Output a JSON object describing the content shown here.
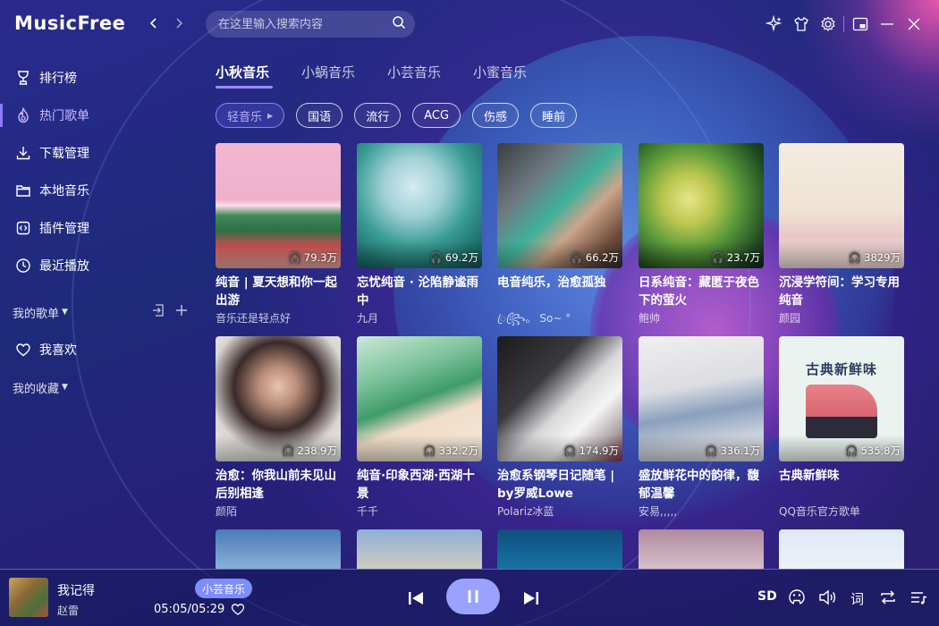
{
  "app": {
    "title": "MusicFree"
  },
  "search": {
    "placeholder": "在这里输入搜索内容"
  },
  "sidebar": {
    "items": [
      {
        "label": "排行榜",
        "icon": "trophy-icon"
      },
      {
        "label": "热门歌单",
        "icon": "fire-icon",
        "active": true
      },
      {
        "label": "下载管理",
        "icon": "download-icon"
      },
      {
        "label": "本地音乐",
        "icon": "folder-icon"
      },
      {
        "label": "插件管理",
        "icon": "plugin-icon"
      },
      {
        "label": "最近播放",
        "icon": "clock-icon"
      }
    ],
    "my_playlists": "我的歌单",
    "favorite": "我喜欢",
    "my_collections": "我的收藏"
  },
  "tabs": [
    {
      "label": "小秋音乐",
      "active": true
    },
    {
      "label": "小蜗音乐"
    },
    {
      "label": "小芸音乐"
    },
    {
      "label": "小蜜音乐"
    }
  ],
  "tags": [
    {
      "label": "轻音乐",
      "active": true
    },
    {
      "label": "国语"
    },
    {
      "label": "流行"
    },
    {
      "label": "ACG"
    },
    {
      "label": "伤感"
    },
    {
      "label": "睡前"
    }
  ],
  "playlists": [
    {
      "title": "纯音 | 夏天想和你一起出游",
      "author": "音乐还是轻点好",
      "count": "79.3万"
    },
    {
      "title": "忘忧纯音 · 沦陷静谧雨中",
      "author": "九月",
      "count": "69.2万"
    },
    {
      "title": "电音纯乐，治愈孤独",
      "author": "ꦿ꧂ꦿ。 So~ °",
      "count": "66.2万"
    },
    {
      "title": "日系纯音：藏匿于夜色下的萤火",
      "author": "鲍帅",
      "count": "23.7万"
    },
    {
      "title": "沉浸学符间：学习专用纯音",
      "author": "颜园",
      "count": "3829万"
    },
    {
      "title": "治愈：你我山前未见山后别相逢",
      "author": "颜陌",
      "count": "238.9万"
    },
    {
      "title": "纯音·印象西湖·西湖十景",
      "author": "千千",
      "count": "332.2万"
    },
    {
      "title": "治愈系钢琴日记随笔 | by罗威Lowe",
      "author": "Polariz冰蓝",
      "count": "174.9万"
    },
    {
      "title": "盛放鲜花中的韵律，馥郁温馨",
      "author": "安易,,,,,",
      "count": "336.1万"
    },
    {
      "title": "古典新鲜味",
      "author": "QQ音乐官方歌单",
      "count": "535.8万",
      "cover_text": "古典新鲜味"
    }
  ],
  "player": {
    "title": "我记得",
    "artist": "赵雷",
    "source": "小芸音乐",
    "time": "05:05/05:29",
    "quality": "SD",
    "lyric": "词"
  }
}
